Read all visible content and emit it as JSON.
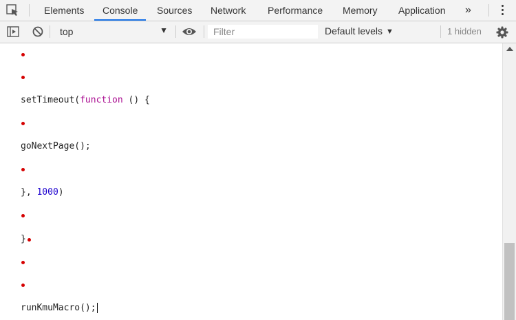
{
  "tabs": [
    {
      "label": "Elements"
    },
    {
      "label": "Console"
    },
    {
      "label": "Sources"
    },
    {
      "label": "Network"
    },
    {
      "label": "Performance"
    },
    {
      "label": "Memory"
    },
    {
      "label": "Application"
    }
  ],
  "active_tab": "Console",
  "overflow_glyph": "»",
  "toolbar": {
    "context": "top",
    "context_arrow": "▼",
    "filter_placeholder": "Filter",
    "levels": "Default levels",
    "levels_arrow": "▼",
    "hidden": "1 hidden"
  },
  "console": {
    "timeout_open_prefix": "setTimeout(",
    "timeout_open_keyword": "function",
    "timeout_open_suffix": " () {",
    "next_page": "goNextPage();",
    "timeout_close_prefix": "}, ",
    "timeout_close_value": "1000",
    "timeout_close_suffix": ")",
    "brace": "}",
    "run_macro": "runKmuMacro();"
  },
  "colors": {
    "accent": "#1a73e8",
    "keyword": "#aa0d91",
    "number": "#1c00cf",
    "bullet": "#d50000"
  }
}
